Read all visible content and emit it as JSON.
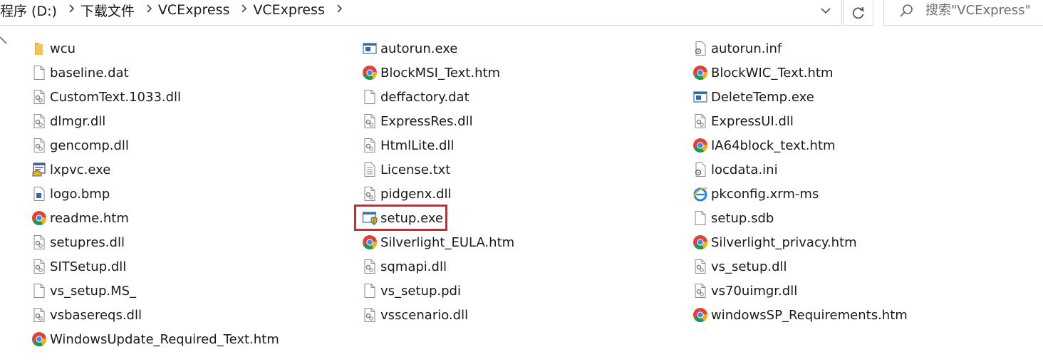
{
  "breadcrumb": {
    "items": [
      "程序 (D:)",
      "下载文件",
      "VCExpress",
      "VCExpress"
    ]
  },
  "search": {
    "placeholder": "搜索\"VCExpress\""
  },
  "colors": {
    "highlight": "#d9232e",
    "folder": "#f4c64e"
  },
  "files": [
    {
      "name": "wcu",
      "icon": "folder-icon"
    },
    {
      "name": "baseline.dat",
      "icon": "blank-file-icon"
    },
    {
      "name": "CustomText.1033.dll",
      "icon": "dll-file-icon"
    },
    {
      "name": "dlmgr.dll",
      "icon": "dll-file-icon"
    },
    {
      "name": "gencomp.dll",
      "icon": "dll-file-icon"
    },
    {
      "name": "lxpvc.exe",
      "icon": "installer-exe-icon"
    },
    {
      "name": "logo.bmp",
      "icon": "bitmap-icon"
    },
    {
      "name": "readme.htm",
      "icon": "chrome-icon"
    },
    {
      "name": "setupres.dll",
      "icon": "dll-file-icon"
    },
    {
      "name": "SITSetup.dll",
      "icon": "dll-file-icon"
    },
    {
      "name": "vs_setup.MS_",
      "icon": "blank-file-icon"
    },
    {
      "name": "vsbasereqs.dll",
      "icon": "dll-file-icon"
    },
    {
      "name": "WindowsUpdate_Required_Text.htm",
      "icon": "chrome-icon"
    },
    {
      "name": "autorun.exe",
      "icon": "app-exe-icon"
    },
    {
      "name": "BlockMSI_Text.htm",
      "icon": "chrome-icon"
    },
    {
      "name": "deffactory.dat",
      "icon": "blank-file-icon"
    },
    {
      "name": "ExpressRes.dll",
      "icon": "dll-file-icon"
    },
    {
      "name": "HtmlLite.dll",
      "icon": "dll-file-icon"
    },
    {
      "name": "License.txt",
      "icon": "text-file-icon"
    },
    {
      "name": "pidgenx.dll",
      "icon": "dll-file-icon"
    },
    {
      "name": "setup.exe",
      "icon": "setup-exe-icon"
    },
    {
      "name": "Silverlight_EULA.htm",
      "icon": "chrome-icon"
    },
    {
      "name": "sqmapi.dll",
      "icon": "dll-file-icon"
    },
    {
      "name": "vs_setup.pdi",
      "icon": "blank-file-icon"
    },
    {
      "name": "vsscenario.dll",
      "icon": "dll-file-icon"
    },
    {
      "name": "autorun.inf",
      "icon": "config-file-icon"
    },
    {
      "name": "BlockWIC_Text.htm",
      "icon": "chrome-icon"
    },
    {
      "name": "DeleteTemp.exe",
      "icon": "app-exe-icon"
    },
    {
      "name": "ExpressUI.dll",
      "icon": "dll-file-icon"
    },
    {
      "name": "IA64block_text.htm",
      "icon": "chrome-icon"
    },
    {
      "name": "locdata.ini",
      "icon": "config-file-icon"
    },
    {
      "name": "pkconfig.xrm-ms",
      "icon": "ie-icon"
    },
    {
      "name": "setup.sdb",
      "icon": "blank-file-icon"
    },
    {
      "name": "Silverlight_privacy.htm",
      "icon": "chrome-icon"
    },
    {
      "name": "vs_setup.dll",
      "icon": "dll-file-icon"
    },
    {
      "name": "vs70uimgr.dll",
      "icon": "dll-file-icon"
    },
    {
      "name": "windowsSP_Requirements.htm",
      "icon": "chrome-icon"
    }
  ]
}
